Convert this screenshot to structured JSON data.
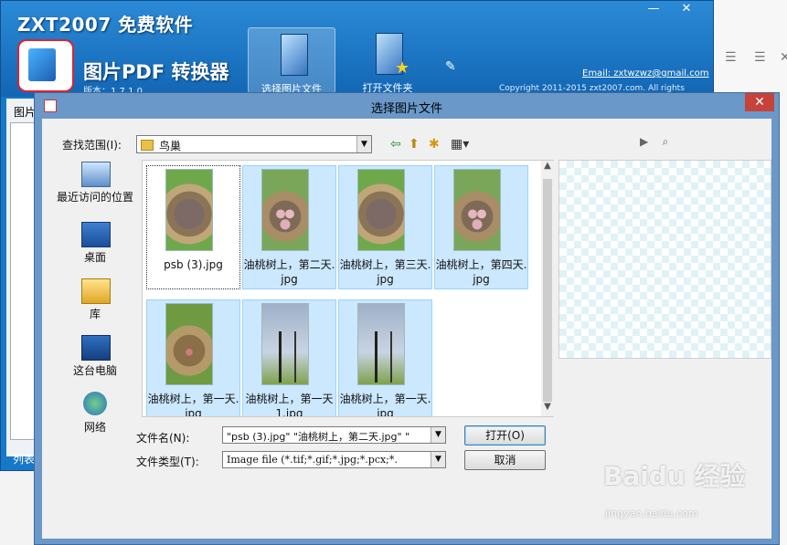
{
  "app": {
    "title": "ZXT2007 免费软件",
    "subtitle": "图片PDF 转换器",
    "version": "版本：1.7.1.0",
    "email": "Email: zxtwzwz@gmail.com",
    "copyright": "Copyright 2011-2015 zxt2007.com. All rights reserved.",
    "toolbar": [
      {
        "label": "选择图片文件",
        "icon": "image-file-icon"
      },
      {
        "label": "打开文件夹",
        "icon": "folder-star-icon"
      }
    ],
    "left_panel_label": "图片",
    "list_label": "列表"
  },
  "dialog": {
    "title": "选择图片文件",
    "look_in_label": "查找范围(I):",
    "look_in_value": "鸟巢",
    "places": [
      {
        "label": "最近访问的位置",
        "icon": "recent-places-icon"
      },
      {
        "label": "桌面",
        "icon": "desktop-icon"
      },
      {
        "label": "库",
        "icon": "libraries-icon"
      },
      {
        "label": "这台电脑",
        "icon": "this-pc-icon"
      },
      {
        "label": "网络",
        "icon": "network-icon"
      }
    ],
    "files": [
      {
        "name": "psb (3).jpg",
        "thumb": "nest-empty",
        "selected": true
      },
      {
        "name": "油桃树上，第二天.jpg",
        "thumb": "nest-eggs"
      },
      {
        "name": "油桃树上，第三天.jpg",
        "thumb": "nest-empty"
      },
      {
        "name": "油桃树上，第四天.jpg",
        "thumb": "nest-eggs"
      },
      {
        "name": "油桃树上，第一天.jpg",
        "thumb": "nest-one"
      },
      {
        "name": "油桃树上，第一天1.jpg",
        "thumb": "tree"
      },
      {
        "name": "油桃树上，第一天.jpg",
        "thumb": "tree"
      }
    ],
    "filename_label": "文件名(N):",
    "filename_value": "\"psb (3).jpg\" \"油桃树上，第二天.jpg\" \"",
    "filetype_label": "文件类型(T):",
    "filetype_value": "Image file (*.tif;*.gif;*.jpg;*.pcx;*.",
    "open_button": "打开(O)",
    "cancel_button": "取消"
  },
  "watermark": {
    "text": "Baidu 经验",
    "sub": "jingyan.baidu.com"
  }
}
